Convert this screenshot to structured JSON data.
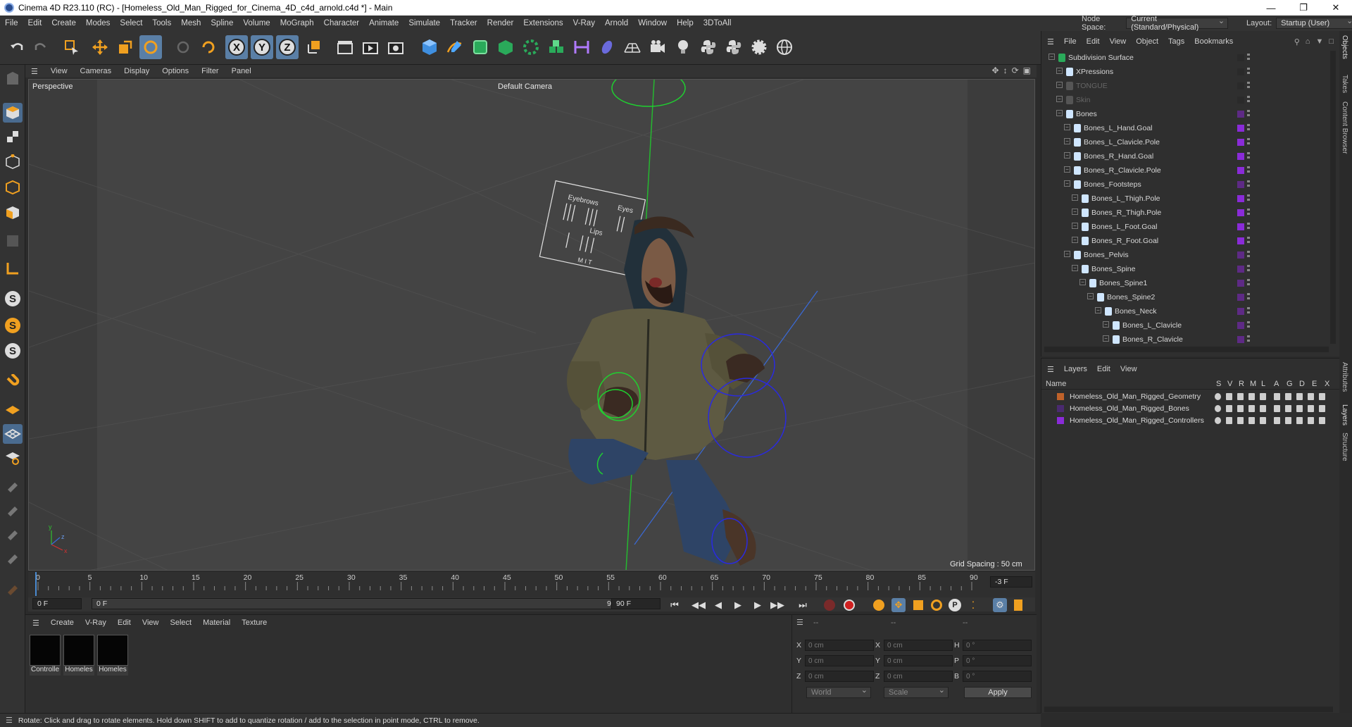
{
  "window": {
    "title": "Cinema 4D R23.110 (RC) - [Homeless_Old_Man_Rigged_for_Cinema_4D_c4d_arnold.c4d *] - Main"
  },
  "menu": [
    "File",
    "Edit",
    "Create",
    "Modes",
    "Select",
    "Tools",
    "Mesh",
    "Spline",
    "Volume",
    "MoGraph",
    "Character",
    "Animate",
    "Simulate",
    "Tracker",
    "Render",
    "Extensions",
    "V-Ray",
    "Arnold",
    "Window",
    "Help",
    "3DToAll"
  ],
  "nodespace": {
    "label": "Node Space:",
    "value": "Current (Standard/Physical)",
    "layout_label": "Layout:",
    "layout_value": "Startup (User)"
  },
  "viewport": {
    "menu": [
      "View",
      "Cameras",
      "Display",
      "Options",
      "Filter",
      "Panel"
    ],
    "name": "Perspective",
    "camera": "Default Camera",
    "grid_spacing": "Grid Spacing : 50 cm",
    "hud": {
      "left_labels": [
        "Eyebrows",
        "Eyes"
      ],
      "mid_label": "Lips",
      "bottom_label": "M I T"
    }
  },
  "timeline": {
    "ticks": [
      "0",
      "5",
      "10",
      "15",
      "20",
      "25",
      "30",
      "35",
      "40",
      "45",
      "50",
      "55",
      "60",
      "65",
      "70",
      "75",
      "80",
      "85",
      "90"
    ],
    "current_frame": "-3 F",
    "start": "0 F",
    "range_start": "0 F",
    "range_end": "90 F",
    "end": "90 F"
  },
  "materials": {
    "menu": [
      "Create",
      "V-Ray",
      "Edit",
      "View",
      "Select",
      "Material",
      "Texture"
    ],
    "items": [
      "Controlle",
      "Homeles",
      "Homeles"
    ]
  },
  "coords": {
    "headers": [
      "--",
      "--",
      "--"
    ],
    "pos": [
      {
        "axis": "X",
        "value": "0 cm"
      },
      {
        "axis": "Y",
        "value": "0 cm"
      },
      {
        "axis": "Z",
        "value": "0 cm"
      }
    ],
    "size": [
      {
        "axis": "X",
        "value": "0 cm"
      },
      {
        "axis": "Y",
        "value": "0 cm"
      },
      {
        "axis": "Z",
        "value": "0 cm"
      }
    ],
    "rot": [
      {
        "axis": "H",
        "value": "0 °"
      },
      {
        "axis": "P",
        "value": "0 °"
      },
      {
        "axis": "B",
        "value": "0 °"
      }
    ],
    "world": "World",
    "scale": "Scale",
    "apply": "Apply"
  },
  "objects": {
    "menu": [
      "File",
      "Edit",
      "View",
      "Object",
      "Tags",
      "Bookmarks"
    ],
    "rows": [
      {
        "label": "Subdivision Surface",
        "color": "#2a2a2a"
      },
      {
        "label": "XPressions",
        "color": "#2a2a2a"
      },
      {
        "label": "TONGUE",
        "color": "#2a2a2a"
      },
      {
        "label": "Skin",
        "color": "#2a2a2a"
      },
      {
        "label": "Bones",
        "color": "#5e2a85"
      },
      {
        "label": "Bones_L_Hand.Goal",
        "color": "#8a2bd8"
      },
      {
        "label": "Bones_L_Clavicle.Pole",
        "color": "#8a2bd8"
      },
      {
        "label": "Bones_R_Hand.Goal",
        "color": "#8a2bd8"
      },
      {
        "label": "Bones_R_Clavicle.Pole",
        "color": "#8a2bd8"
      },
      {
        "label": "Bones_Footsteps",
        "color": "#5e2a85"
      },
      {
        "label": "Bones_L_Thigh.Pole",
        "color": "#8a2bd8"
      },
      {
        "label": "Bones_R_Thigh.Pole",
        "color": "#8a2bd8"
      },
      {
        "label": "Bones_L_Foot.Goal",
        "color": "#8a2bd8"
      },
      {
        "label": "Bones_R_Foot.Goal",
        "color": "#8a2bd8"
      },
      {
        "label": "Bones_Pelvis",
        "color": "#5e2a85"
      },
      {
        "label": "Bones_Spine",
        "color": "#5e2a85"
      },
      {
        "label": "Bones_Spine1",
        "color": "#5e2a85"
      },
      {
        "label": "Bones_Spine2",
        "color": "#5e2a85"
      },
      {
        "label": "Bones_Neck",
        "color": "#5e2a85"
      },
      {
        "label": "Bones_L_Clavicle",
        "color": "#5e2a85"
      },
      {
        "label": "Bones_R_Clavicle",
        "color": "#5e2a85"
      }
    ]
  },
  "layers": {
    "menu": [
      "Layers",
      "Edit",
      "View"
    ],
    "columns": [
      "Name",
      "S",
      "V",
      "R",
      "M",
      "L",
      "A",
      "G",
      "D",
      "E",
      "X"
    ],
    "rows": [
      {
        "name": "Homeless_Old_Man_Rigged_Geometry",
        "color": "#c0622a"
      },
      {
        "name": "Homeless_Old_Man_Rigged_Bones",
        "color": "#4a2a70"
      },
      {
        "name": "Homeless_Old_Man_Rigged_Controllers",
        "color": "#8a2bd8"
      }
    ]
  },
  "sidetabs": [
    "Objects",
    "Takes",
    "Content Browser",
    "Attributes",
    "Layers",
    "Structure"
  ],
  "status": "Rotate: Click and drag to rotate elements. Hold down SHIFT to add to quantize rotation / add to the selection in point mode, CTRL to remove."
}
